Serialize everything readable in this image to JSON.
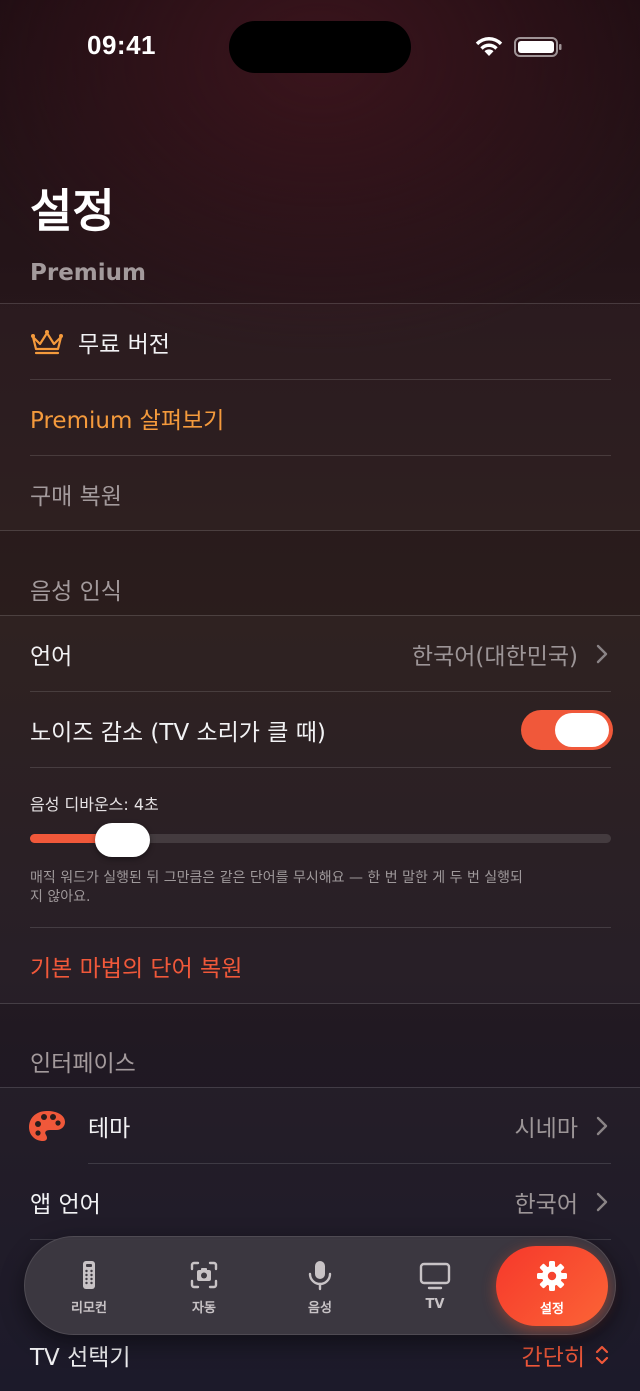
{
  "status_bar": {
    "time": "09:41"
  },
  "page": {
    "title": "설정"
  },
  "premium_section": {
    "header": "Premium",
    "free_version_label": "무료 버전",
    "explore_premium_label": "Premium 살펴보기",
    "restore_purchase_label": "구매 복원"
  },
  "voice_section": {
    "header": "음성 인식",
    "language_label": "언어",
    "language_value": "한국어(대한민국)",
    "noise_reduction_label": "노이즈 감소 (TV 소리가 클 때)",
    "noise_reduction_on": true,
    "debounce_label": "음성 디바운스: 4초",
    "debounce_fraction": 0.16,
    "debounce_note": "매직 워드가 실행된 뒤 그만큼은 같은 단어를 무시해요 — 한 번 말한 게 두 번 실행되지 않아요.",
    "restore_magic_words_label": "기본 마법의 단어 복원"
  },
  "interface_section": {
    "header": "인터페이스",
    "theme_label": "테마",
    "theme_value": "시네마",
    "app_language_label": "앱 언어",
    "app_language_value": "한국어",
    "tv_selector_label": "TV 선택기",
    "tv_selector_value": "간단히"
  },
  "tab_bar": {
    "tabs": [
      {
        "label": "리모컨",
        "icon": "remote-icon"
      },
      {
        "label": "자동",
        "icon": "camera-scan-icon"
      },
      {
        "label": "음성",
        "icon": "microphone-icon"
      },
      {
        "label": "TV",
        "icon": "tv-icon"
      },
      {
        "label": "설정",
        "icon": "gear-icon"
      }
    ],
    "active_index": 4
  },
  "colors": {
    "accent_red": "#f0583a",
    "accent_orange": "#f49a3c",
    "toggle_on": "#f0583a"
  }
}
